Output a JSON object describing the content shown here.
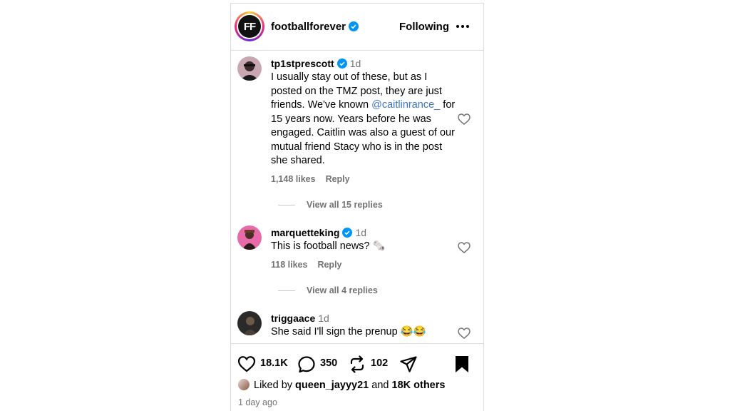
{
  "header": {
    "logo_text": "FF",
    "account": "footballforever",
    "follow_label": "Following",
    "more_icon": "more-horizontal-icon"
  },
  "comments": [
    {
      "username": "tp1stprescott",
      "time": "1d",
      "verified": true,
      "text_before": "I usually stay out of these, but as I posted on the TMZ post, they are just friends. We've known ",
      "mention": "@caitlinrance_",
      "text_after": " for 15 years now. Years before he was engaged. Caitlin was also a guest of our mutual friend Stacy who is in the post she shared.",
      "likes": "1,148 likes",
      "reply": "Reply",
      "view_replies": "View all 15 replies"
    },
    {
      "username": "marquetteking",
      "time": "1d",
      "verified": true,
      "text": "This is football news? 🗞️",
      "likes": "118 likes",
      "reply": "Reply",
      "view_replies": "View all 4 replies"
    },
    {
      "username": "triggaace",
      "time": "1d",
      "verified": false,
      "text": "She said I'll sign the prenup 😂😂"
    }
  ],
  "actions": {
    "like_count": "18.1K",
    "comment_count": "350",
    "repost_count": "102"
  },
  "liked_by": {
    "prefix": "Liked by",
    "user": "queen_jayyy21",
    "middle": "and",
    "others": "18K others"
  },
  "timestamp": "1 day ago",
  "colors": {
    "accent": "#0095f6",
    "mention": "#3b74c8",
    "muted": "#737373"
  }
}
